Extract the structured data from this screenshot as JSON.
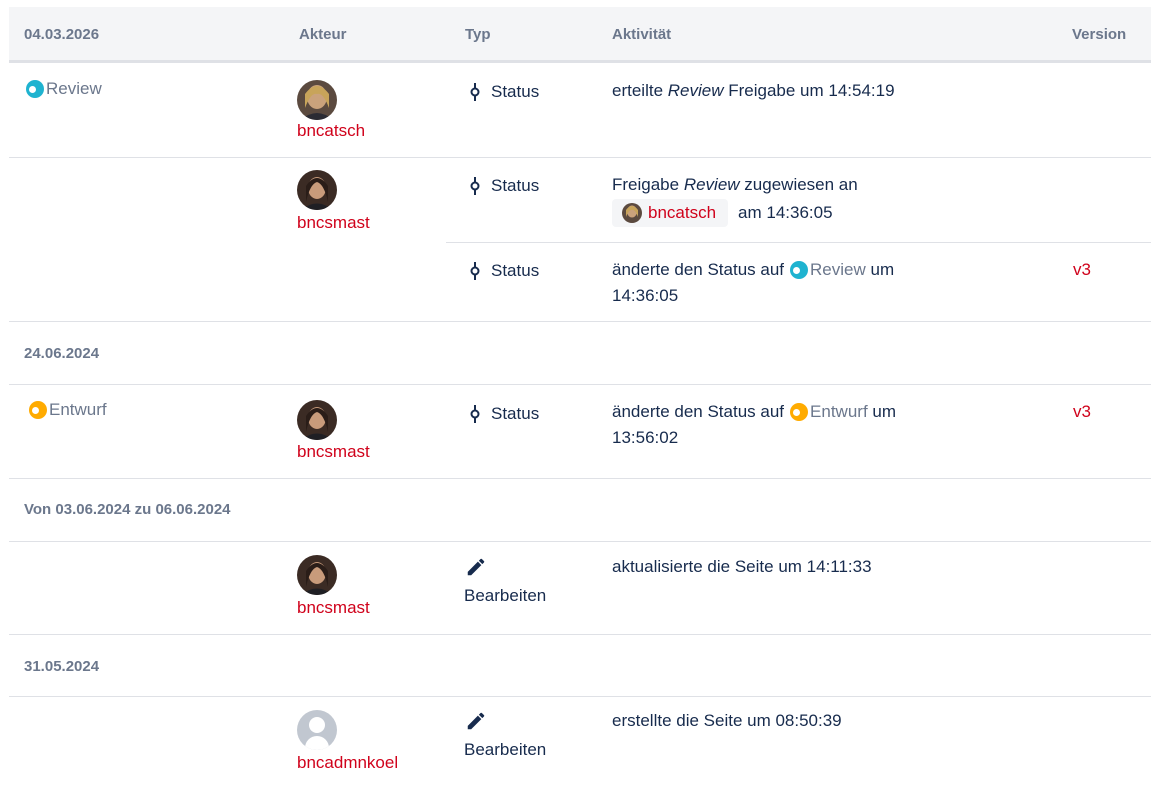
{
  "header": {
    "date": "04.03.2026",
    "actor": "Akteur",
    "type": "Typ",
    "activity": "Aktivität",
    "version": "Version"
  },
  "colors": {
    "review": "#1fb3d0",
    "draft": "#ffab00",
    "link": "#d0021b"
  },
  "rows": {
    "r1": {
      "state": "Review",
      "user": "bncatsch",
      "type": "Status",
      "activity_a": "erteilte ",
      "activity_i": "Review",
      "activity_b": " Freigabe um 14:54:19"
    },
    "r2": {
      "user": "bncsmast",
      "type": "Status",
      "activity_a": "Freigabe ",
      "activity_i": "Review",
      "activity_b": " zugewiesen an",
      "mention": "bncatsch",
      "activity_c": "am 14:36:05"
    },
    "r3": {
      "type": "Status",
      "activity_a": "änderte den Status auf",
      "state": "Review",
      "activity_b": " um",
      "activity_c": "14:36:05",
      "version": "v3"
    },
    "r4": {
      "state": "Entwurf",
      "user": "bncsmast",
      "type": "Status",
      "activity_a": "änderte den Status auf",
      "inline_state": "Entwurf",
      "activity_b": " um",
      "activity_c": "13:56:02",
      "version": "v3"
    },
    "r5": {
      "user": "bncsmast",
      "type": "Bearbeiten",
      "activity": "aktualisierte die Seite um 14:11:33"
    },
    "r6": {
      "user": "bncadmnkoel",
      "type": "Bearbeiten",
      "activity": "erstellte die Seite um 08:50:39"
    }
  },
  "groups": {
    "g2": "24.06.2024",
    "g3": "Von 03.06.2024 zu 06.06.2024",
    "g4": "31.05.2024"
  }
}
